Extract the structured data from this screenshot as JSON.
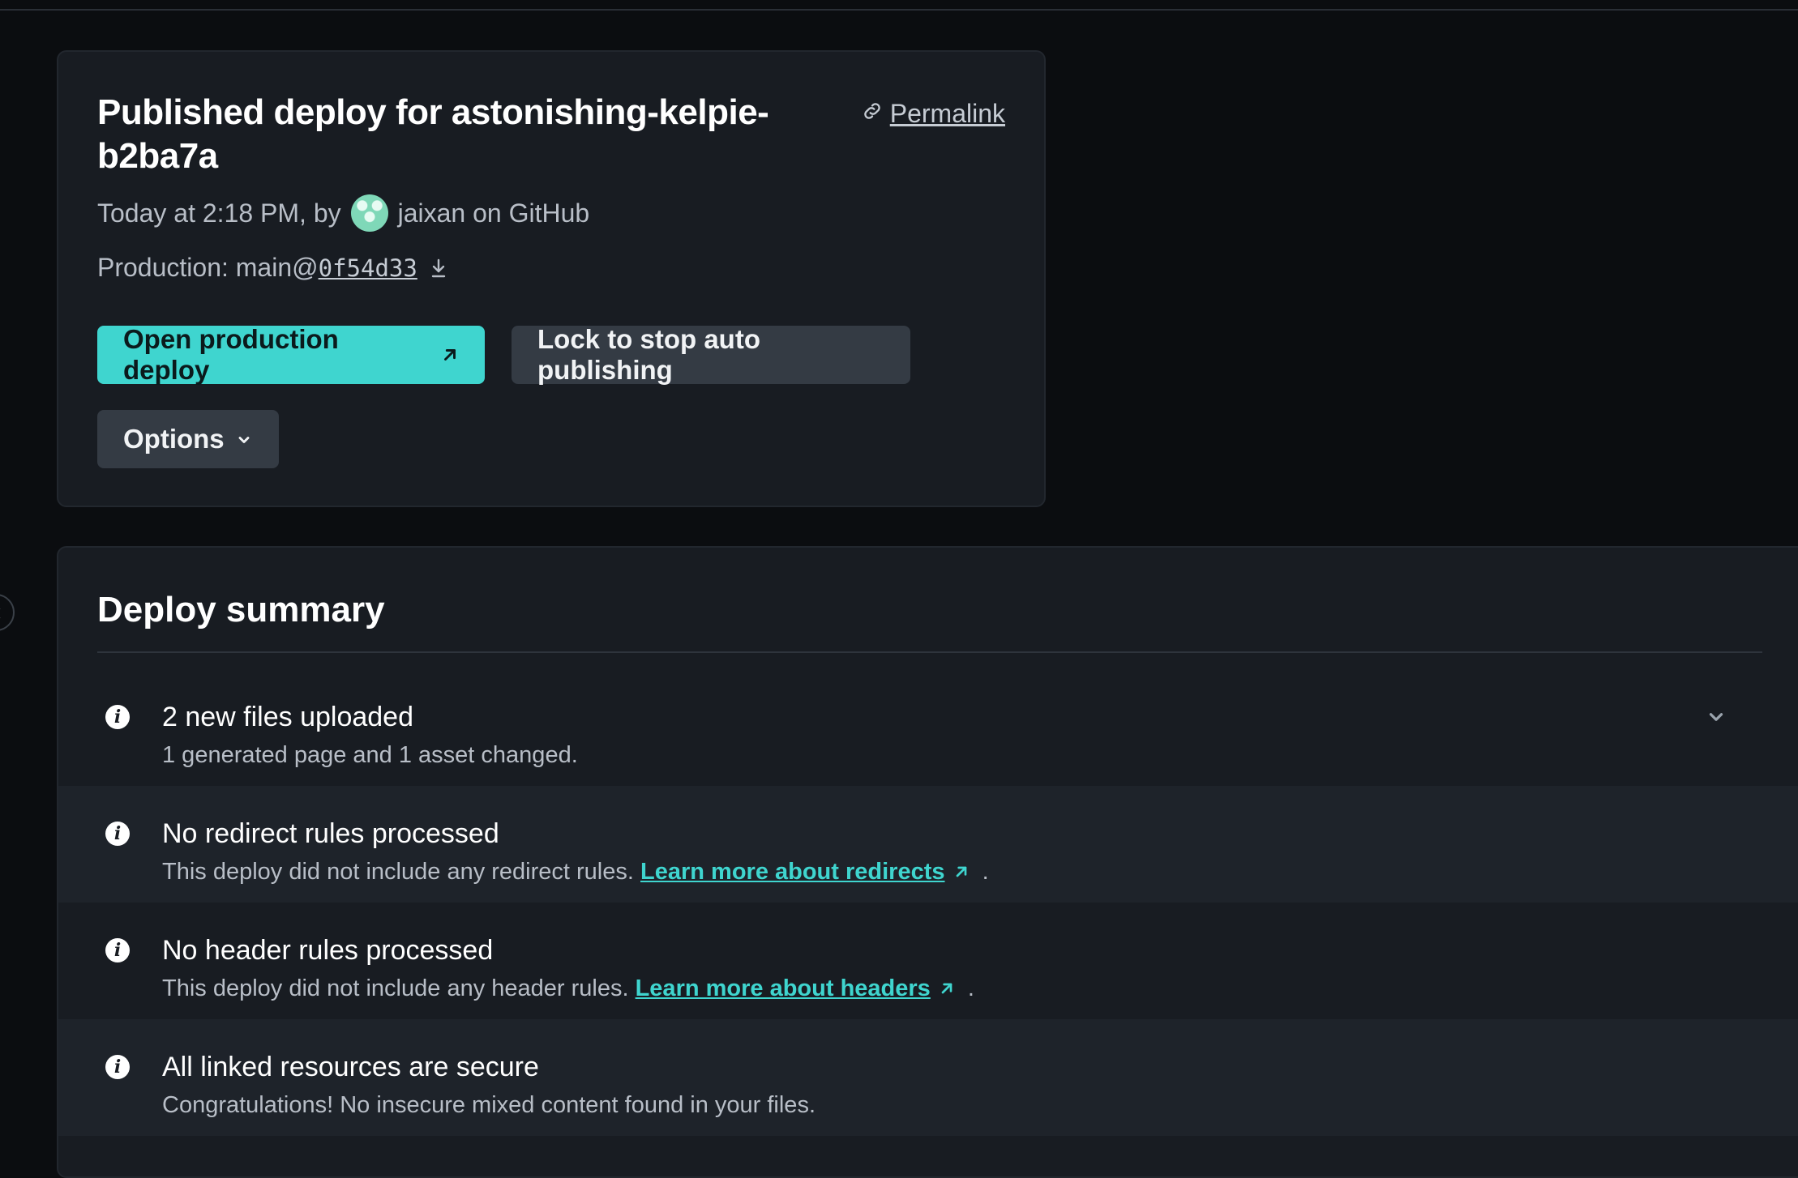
{
  "deploy_card": {
    "title": "Published deploy for astonishing-kelpie-b2ba7a",
    "permalink_label": "Permalink",
    "time_text": "Today at 2:18 PM, by",
    "author_text": "jaixan on GitHub",
    "production_prefix": "Production: main@",
    "commit_hash": "0f54d33",
    "open_button_label": "Open production deploy",
    "lock_button_label": "Lock to stop auto publishing",
    "options_button_label": "Options"
  },
  "summary": {
    "title": "Deploy summary",
    "rows": [
      {
        "title": "2 new files uploaded",
        "desc": "1 generated page and 1 asset changed."
      },
      {
        "title": "No redirect rules processed",
        "desc": "This deploy did not include any redirect rules.",
        "link": "Learn more about redirects",
        "trail": "."
      },
      {
        "title": "No header rules processed",
        "desc": "This deploy did not include any header rules.",
        "link": "Learn more about headers",
        "trail": "."
      },
      {
        "title": "All linked resources are secure",
        "desc": "Congratulations! No insecure mixed content found in your files."
      }
    ]
  },
  "icons": {
    "link": "link-icon",
    "download": "download-icon",
    "external": "external-link-icon",
    "chevron": "chevron-down-icon",
    "info": "info-icon"
  },
  "colors": {
    "accent": "#3fd5cf",
    "background": "#0b0d10",
    "card": "#181c22"
  }
}
